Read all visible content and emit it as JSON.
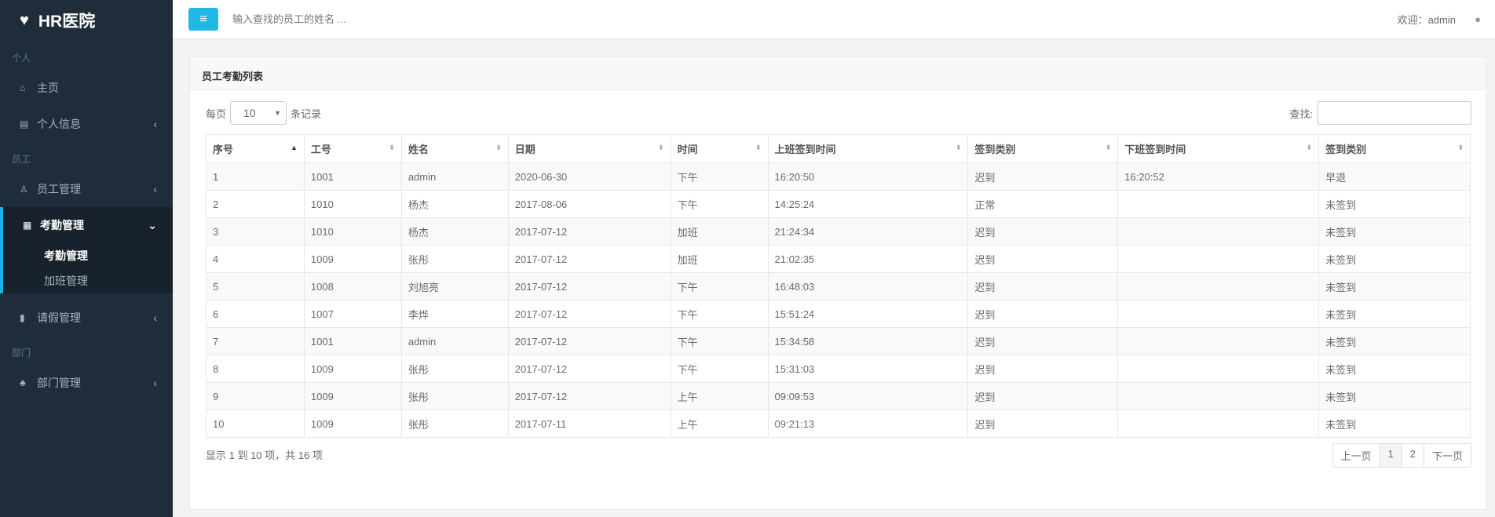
{
  "app": {
    "title": "HR医院"
  },
  "sidebar": {
    "sections": [
      {
        "label": "个人",
        "items": [
          {
            "label": "主页",
            "icon": "home-icon"
          },
          {
            "label": "个人信息",
            "icon": "id-card-icon"
          }
        ]
      },
      {
        "label": "员工",
        "items": [
          {
            "label": "员工管理",
            "icon": "user-icon"
          },
          {
            "label": "考勤管理",
            "icon": "calendar-icon",
            "subitems": [
              "考勤管理",
              "加班管理"
            ]
          },
          {
            "label": "请假管理",
            "icon": "bookmark-icon"
          }
        ]
      },
      {
        "label": "部门",
        "items": [
          {
            "label": "部门管理",
            "icon": "sitemap-icon"
          }
        ]
      }
    ]
  },
  "header": {
    "search_placeholder": "输入查找的员工的姓名 ...",
    "welcome": "欢迎：admin"
  },
  "panel": {
    "title": "员工考勤列表",
    "per_page_prefix": "每页",
    "per_page_value": "10",
    "per_page_suffix": "条记录",
    "search_label": "查找:"
  },
  "table": {
    "columns": [
      "序号",
      "工号",
      "姓名",
      "日期",
      "时间",
      "上班签到时间",
      "签到类别",
      "下班签到时间",
      "签到类别"
    ],
    "rows": [
      [
        "1",
        "1001",
        "admin",
        "2020-06-30",
        "下午",
        "16:20:50",
        "迟到",
        "16:20:52",
        "早退"
      ],
      [
        "2",
        "1010",
        "杨杰",
        "2017-08-06",
        "下午",
        "14:25:24",
        "正常",
        "",
        "未签到"
      ],
      [
        "3",
        "1010",
        "杨杰",
        "2017-07-12",
        "加班",
        "21:24:34",
        "迟到",
        "",
        "未签到"
      ],
      [
        "4",
        "1009",
        "张彤",
        "2017-07-12",
        "加班",
        "21:02:35",
        "迟到",
        "",
        "未签到"
      ],
      [
        "5",
        "1008",
        "刘旭亮",
        "2017-07-12",
        "下午",
        "16:48:03",
        "迟到",
        "",
        "未签到"
      ],
      [
        "6",
        "1007",
        "李烨",
        "2017-07-12",
        "下午",
        "15:51:24",
        "迟到",
        "",
        "未签到"
      ],
      [
        "7",
        "1001",
        "admin",
        "2017-07-12",
        "下午",
        "15:34:58",
        "迟到",
        "",
        "未签到"
      ],
      [
        "8",
        "1009",
        "张彤",
        "2017-07-12",
        "下午",
        "15:31:03",
        "迟到",
        "",
        "未签到"
      ],
      [
        "9",
        "1009",
        "张彤",
        "2017-07-12",
        "上午",
        "09:09:53",
        "迟到",
        "",
        "未签到"
      ],
      [
        "10",
        "1009",
        "张彤",
        "2017-07-11",
        "上午",
        "09:21:13",
        "迟到",
        "",
        "未签到"
      ]
    ]
  },
  "footer": {
    "info": "显示 1 到 10 项，共 16 项",
    "prev": "上一页",
    "pages": [
      "1",
      "2"
    ],
    "next": "下一页"
  }
}
